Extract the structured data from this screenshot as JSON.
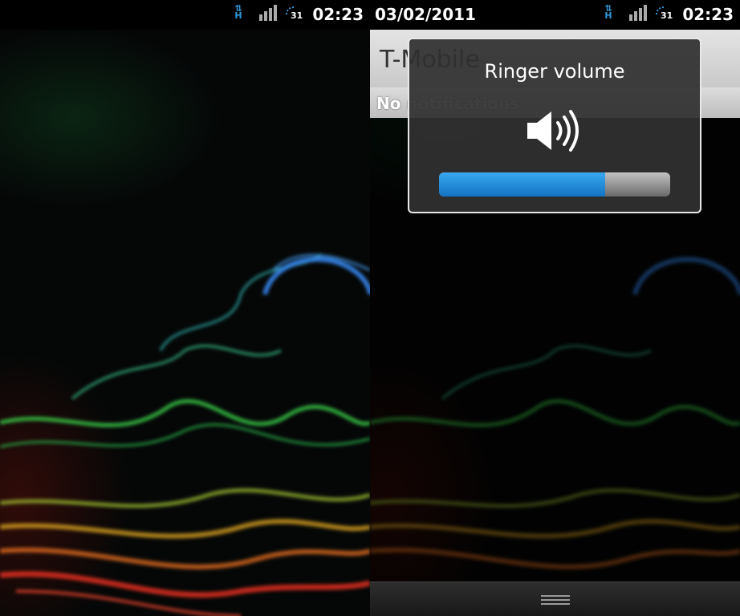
{
  "left_screen": {
    "status_bar": {
      "clock": "02:23",
      "battery_level": "31"
    }
  },
  "right_screen": {
    "status_bar": {
      "date": "03/02/2011",
      "clock": "02:23",
      "battery_level": "31"
    },
    "notification_shade": {
      "carrier": "T-Mobile",
      "header": "No notifications"
    },
    "volume_panel": {
      "title": "Ringer volume",
      "icon": "speaker-volume-icon",
      "level": 0.72
    }
  },
  "colors": {
    "accent_blue": "#1a8fe0",
    "status_icon_blue": "#2e9be0",
    "panel_border": "#e8e8e8"
  }
}
